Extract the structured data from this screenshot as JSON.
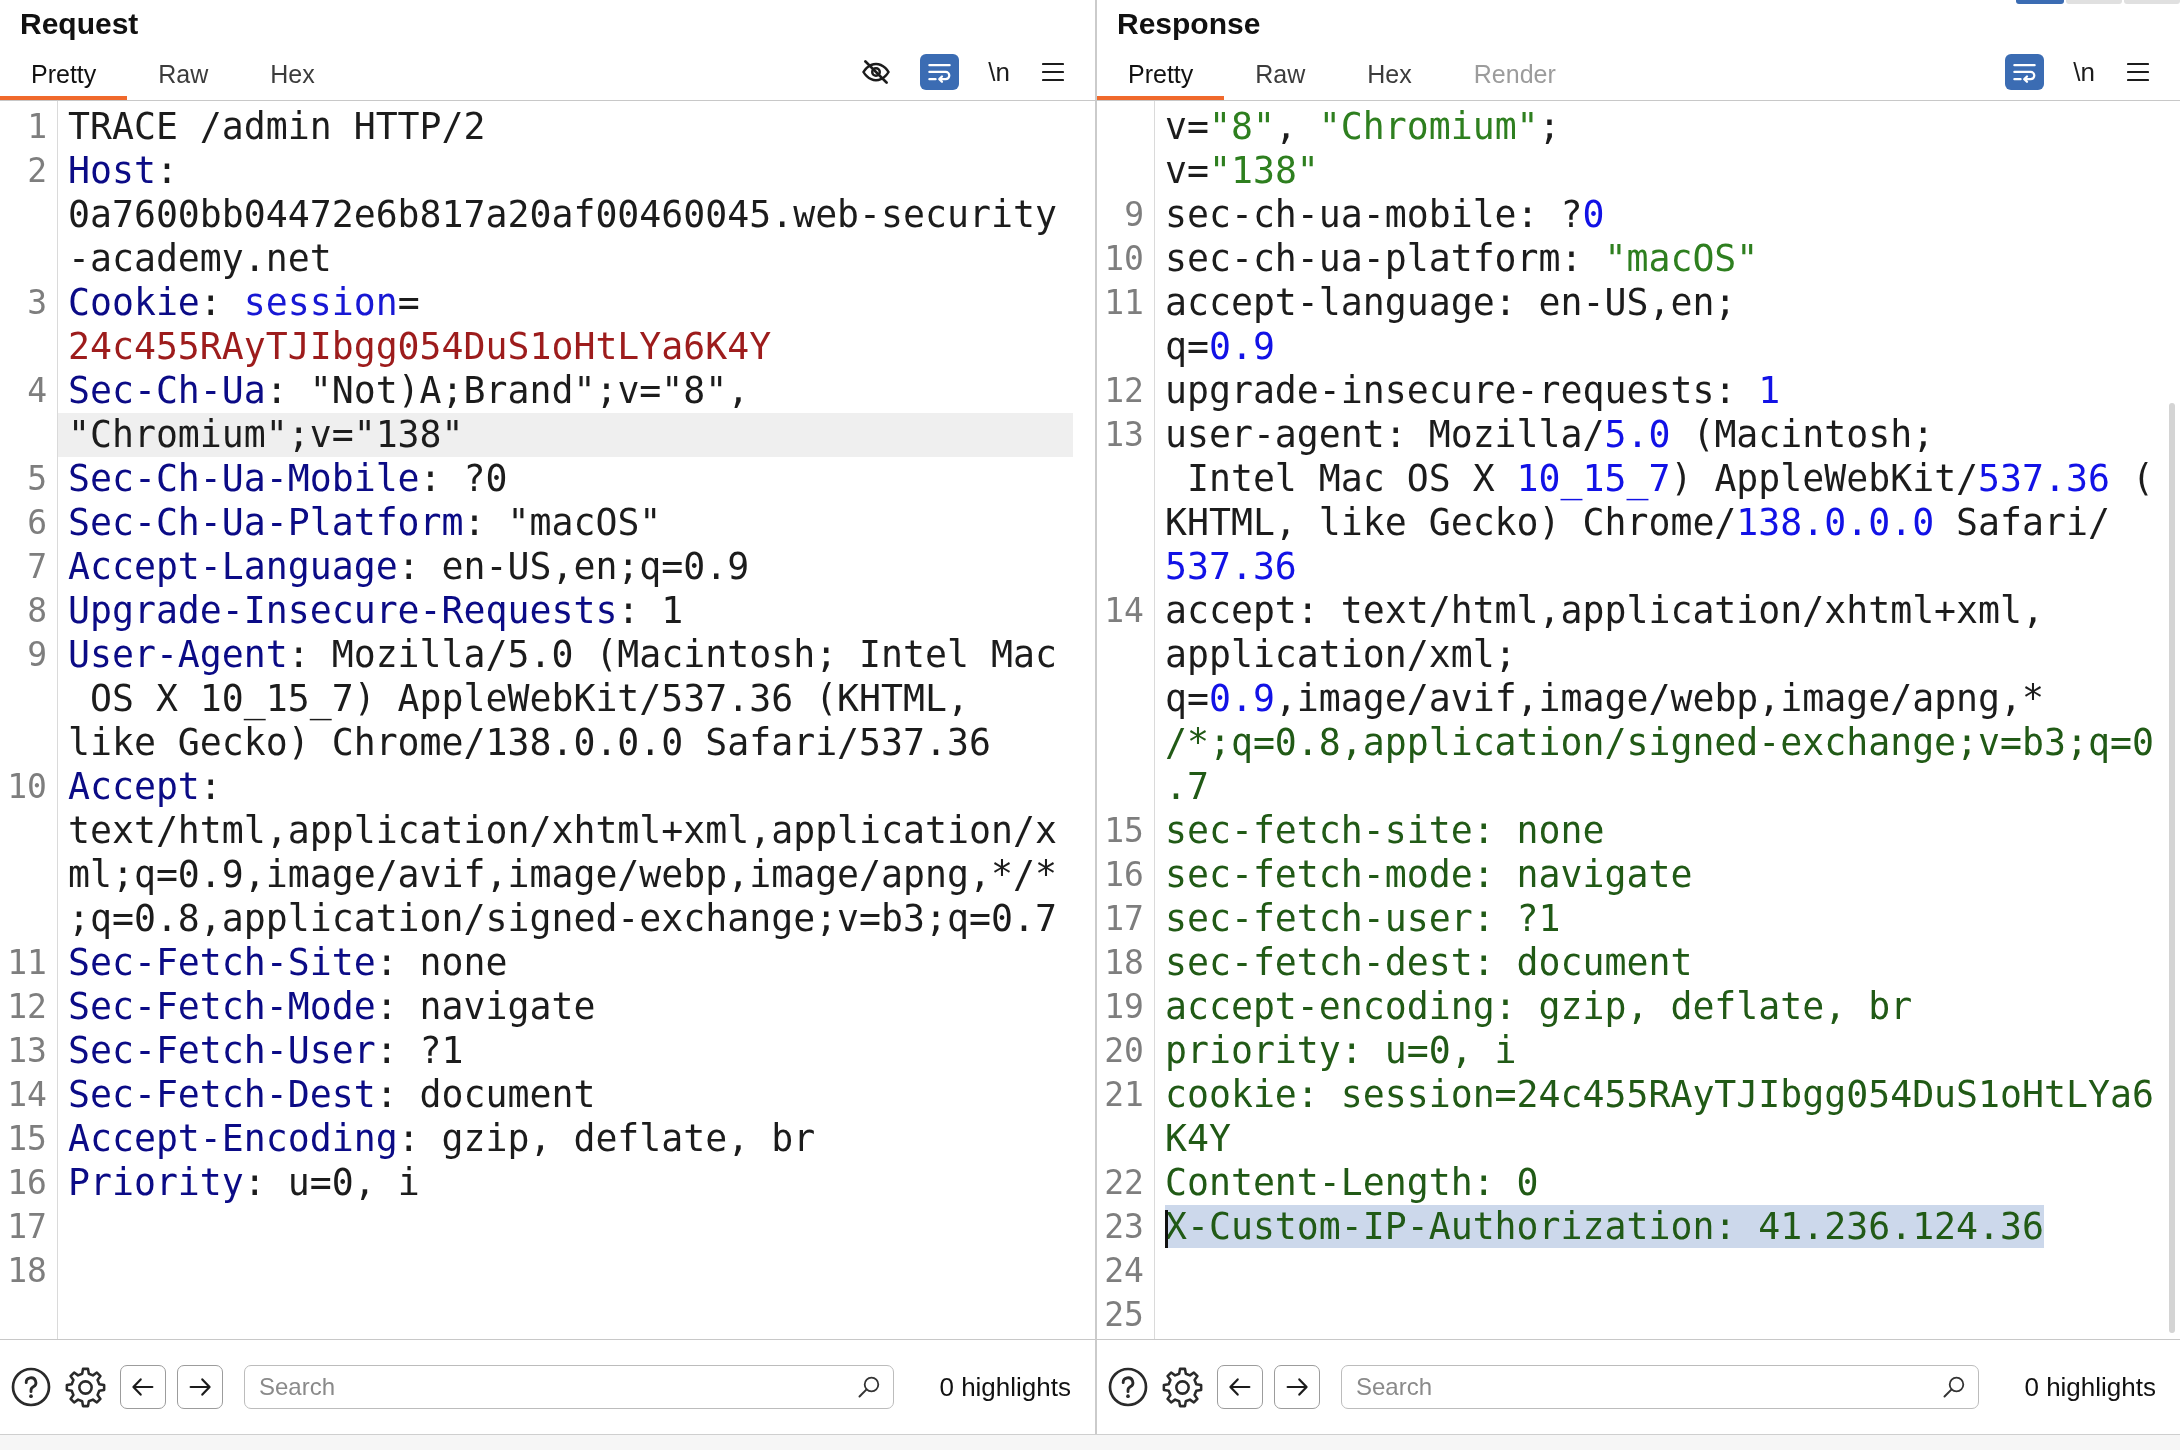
{
  "panels": [
    {
      "title": "Request",
      "tabs": [
        {
          "label": "Pretty",
          "selected": true,
          "disabled": false
        },
        {
          "label": "Raw",
          "selected": false,
          "disabled": false
        },
        {
          "label": "Hex",
          "selected": false,
          "disabled": false
        }
      ],
      "toolbar": [
        {
          "kind": "hide-toggle",
          "on": false
        },
        {
          "kind": "wrap-toggle",
          "on": true
        },
        {
          "kind": "newline-toggle",
          "label": "\\n",
          "on": false
        },
        {
          "kind": "menu"
        }
      ],
      "lines": [
        {
          "number": "1",
          "rows": [
            {
              "tokens": [
                {
                  "kind": "plain",
                  "text": "TRACE /admin HTTP/2"
                }
              ]
            }
          ]
        },
        {
          "number": "2",
          "rows": [
            {
              "tokens": [
                {
                  "kind": "name",
                  "text": "Host"
                },
                {
                  "kind": "plain",
                  "text": ":"
                }
              ]
            },
            {
              "tokens": [
                {
                  "kind": "plain",
                  "text": "0a7600bb04472e6b817a20af00460045.web-security"
                }
              ]
            },
            {
              "tokens": [
                {
                  "kind": "plain",
                  "text": "-academy.net"
                }
              ]
            }
          ]
        },
        {
          "number": "3",
          "rows": [
            {
              "tokens": [
                {
                  "kind": "name",
                  "text": "Cookie"
                },
                {
                  "kind": "plain",
                  "text": ": "
                },
                {
                  "kind": "param",
                  "text": "session"
                },
                {
                  "kind": "plain",
                  "text": "="
                }
              ]
            },
            {
              "tokens": [
                {
                  "kind": "cookie",
                  "text": "24c455RAyTJIbgg054DuS1oHtLYa6K4Y"
                }
              ]
            }
          ]
        },
        {
          "number": "4",
          "rows": [
            {
              "tokens": [
                {
                  "kind": "name",
                  "text": "Sec-Ch-Ua"
                },
                {
                  "kind": "plain",
                  "text": ": \"Not)A;Brand\";v=\"8\","
                }
              ]
            },
            {
              "current_line": true,
              "tokens": [
                {
                  "kind": "plain",
                  "text": "\"Chromium\";v=\"138\""
                }
              ]
            }
          ]
        },
        {
          "number": "5",
          "rows": [
            {
              "tokens": [
                {
                  "kind": "name",
                  "text": "Sec-Ch-Ua-Mobile"
                },
                {
                  "kind": "plain",
                  "text": ": ?0"
                }
              ]
            }
          ]
        },
        {
          "number": "6",
          "rows": [
            {
              "tokens": [
                {
                  "kind": "name",
                  "text": "Sec-Ch-Ua-Platform"
                },
                {
                  "kind": "plain",
                  "text": ": \"macOS\""
                }
              ]
            }
          ]
        },
        {
          "number": "7",
          "rows": [
            {
              "tokens": [
                {
                  "kind": "name",
                  "text": "Accept-Language"
                },
                {
                  "kind": "plain",
                  "text": ": en-US,en;q=0.9"
                }
              ]
            }
          ]
        },
        {
          "number": "8",
          "rows": [
            {
              "tokens": [
                {
                  "kind": "name",
                  "text": "Upgrade-Insecure-Requests"
                },
                {
                  "kind": "plain",
                  "text": ": 1"
                }
              ]
            }
          ]
        },
        {
          "number": "9",
          "rows": [
            {
              "tokens": [
                {
                  "kind": "name",
                  "text": "User-Agent"
                },
                {
                  "kind": "plain",
                  "text": ": Mozilla/5.0 (Macintosh; Intel Mac"
                }
              ]
            },
            {
              "tokens": [
                {
                  "kind": "plain",
                  "text": " OS X 10_15_7) AppleWebKit/537.36 (KHTML,"
                }
              ]
            },
            {
              "tokens": [
                {
                  "kind": "plain",
                  "text": "like Gecko) Chrome/138.0.0.0 Safari/537.36"
                }
              ]
            }
          ]
        },
        {
          "number": "10",
          "rows": [
            {
              "tokens": [
                {
                  "kind": "name",
                  "text": "Accept"
                },
                {
                  "kind": "plain",
                  "text": ":"
                }
              ]
            },
            {
              "tokens": [
                {
                  "kind": "plain",
                  "text": "text/html,application/xhtml+xml,application/x"
                }
              ]
            },
            {
              "tokens": [
                {
                  "kind": "plain",
                  "text": "ml;q=0.9,image/avif,image/webp,image/apng,*/*"
                }
              ]
            },
            {
              "tokens": [
                {
                  "kind": "plain",
                  "text": ";q=0.8,application/signed-exchange;v=b3;q=0.7"
                }
              ]
            }
          ]
        },
        {
          "number": "11",
          "rows": [
            {
              "tokens": [
                {
                  "kind": "name",
                  "text": "Sec-Fetch-Site"
                },
                {
                  "kind": "plain",
                  "text": ": none"
                }
              ]
            }
          ]
        },
        {
          "number": "12",
          "rows": [
            {
              "tokens": [
                {
                  "kind": "name",
                  "text": "Sec-Fetch-Mode"
                },
                {
                  "kind": "plain",
                  "text": ": navigate"
                }
              ]
            }
          ]
        },
        {
          "number": "13",
          "rows": [
            {
              "tokens": [
                {
                  "kind": "name",
                  "text": "Sec-Fetch-User"
                },
                {
                  "kind": "plain",
                  "text": ": ?1"
                }
              ]
            }
          ]
        },
        {
          "number": "14",
          "rows": [
            {
              "tokens": [
                {
                  "kind": "name",
                  "text": "Sec-Fetch-Dest"
                },
                {
                  "kind": "plain",
                  "text": ": document"
                }
              ]
            }
          ]
        },
        {
          "number": "15",
          "rows": [
            {
              "tokens": [
                {
                  "kind": "name",
                  "text": "Accept-Encoding"
                },
                {
                  "kind": "plain",
                  "text": ": gzip, deflate, br"
                }
              ]
            }
          ]
        },
        {
          "number": "16",
          "rows": [
            {
              "tokens": [
                {
                  "kind": "name",
                  "text": "Priority"
                },
                {
                  "kind": "plain",
                  "text": ": u=0, i"
                }
              ]
            }
          ]
        },
        {
          "number": "17"
        },
        {
          "number": "18"
        }
      ],
      "search": {
        "placeholder": "Search"
      },
      "highlights": "0 highlights"
    },
    {
      "title": "Response",
      "view_toggle": [
        {
          "selected": true
        },
        {
          "selected": false
        },
        {
          "selected": false
        }
      ],
      "tabs": [
        {
          "label": "Pretty",
          "selected": true,
          "disabled": false
        },
        {
          "label": "Raw",
          "selected": false,
          "disabled": false
        },
        {
          "label": "Hex",
          "selected": false,
          "disabled": false
        },
        {
          "label": "Render",
          "selected": false,
          "disabled": true
        }
      ],
      "toolbar": [
        {
          "kind": "wrap-toggle",
          "on": true
        },
        {
          "kind": "newline-toggle",
          "label": "\\n",
          "on": false
        },
        {
          "kind": "menu"
        }
      ],
      "scrollbar": true,
      "lines": [
        {
          "rows": [
            {
              "tokens": [
                {
                  "kind": "plain",
                  "text": "v="
                },
                {
                  "kind": "string",
                  "text": "\"8\""
                },
                {
                  "kind": "plain",
                  "text": ", "
                },
                {
                  "kind": "string",
                  "text": "\"Chromium\""
                },
                {
                  "kind": "plain",
                  "text": ";"
                }
              ]
            },
            {
              "tokens": [
                {
                  "kind": "plain",
                  "text": "v="
                },
                {
                  "kind": "string",
                  "text": "\"138\""
                }
              ]
            }
          ]
        },
        {
          "number": "9",
          "rows": [
            {
              "tokens": [
                {
                  "kind": "plain",
                  "text": "sec-ch-ua-mobile: ?"
                },
                {
                  "kind": "number",
                  "text": "0"
                }
              ]
            }
          ]
        },
        {
          "number": "10",
          "rows": [
            {
              "tokens": [
                {
                  "kind": "plain",
                  "text": "sec-ch-ua-platform: "
                },
                {
                  "kind": "string",
                  "text": "\"macOS\""
                }
              ]
            }
          ]
        },
        {
          "number": "11",
          "rows": [
            {
              "tokens": [
                {
                  "kind": "plain",
                  "text": "accept-language: en-US,en;"
                }
              ]
            },
            {
              "tokens": [
                {
                  "kind": "plain",
                  "text": "q="
                },
                {
                  "kind": "number",
                  "text": "0.9"
                }
              ]
            }
          ]
        },
        {
          "number": "12",
          "rows": [
            {
              "tokens": [
                {
                  "kind": "plain",
                  "text": "upgrade-insecure-requests: "
                },
                {
                  "kind": "number",
                  "text": "1"
                }
              ]
            }
          ]
        },
        {
          "number": "13",
          "rows": [
            {
              "tokens": [
                {
                  "kind": "plain",
                  "text": "user-agent: Mozilla/"
                },
                {
                  "kind": "number",
                  "text": "5.0"
                },
                {
                  "kind": "plain",
                  "text": " (Macintosh;"
                }
              ]
            },
            {
              "tokens": [
                {
                  "kind": "plain",
                  "text": " Intel Mac OS X "
                },
                {
                  "kind": "number",
                  "text": "10_15_7"
                },
                {
                  "kind": "plain",
                  "text": ") AppleWebKit/"
                },
                {
                  "kind": "number",
                  "text": "537.36"
                },
                {
                  "kind": "plain",
                  "text": " ("
                }
              ]
            },
            {
              "tokens": [
                {
                  "kind": "plain",
                  "text": "KHTML, like Gecko) Chrome/"
                },
                {
                  "kind": "number",
                  "text": "138.0.0.0"
                },
                {
                  "kind": "plain",
                  "text": " Safari/"
                }
              ]
            },
            {
              "tokens": [
                {
                  "kind": "number",
                  "text": "537.36"
                }
              ]
            }
          ]
        },
        {
          "number": "14",
          "rows": [
            {
              "tokens": [
                {
                  "kind": "plain",
                  "text": "accept: text/html,application/xhtml+xml,"
                }
              ]
            },
            {
              "tokens": [
                {
                  "kind": "plain",
                  "text": "application/xml;"
                }
              ]
            },
            {
              "tokens": [
                {
                  "kind": "plain",
                  "text": "q="
                },
                {
                  "kind": "number",
                  "text": "0.9"
                },
                {
                  "kind": "plain",
                  "text": ",image/avif,image/webp,image/apng,*"
                }
              ]
            },
            {
              "tokens": [
                {
                  "kind": "comment",
                  "text": "/*;q=0.8,application/signed-exchange;v=b3;q=0"
                }
              ]
            },
            {
              "tokens": [
                {
                  "kind": "comment",
                  "text": ".7"
                }
              ]
            }
          ]
        },
        {
          "number": "15",
          "rows": [
            {
              "tokens": [
                {
                  "kind": "comment",
                  "text": "sec-fetch-site: none"
                }
              ]
            }
          ]
        },
        {
          "number": "16",
          "rows": [
            {
              "tokens": [
                {
                  "kind": "comment",
                  "text": "sec-fetch-mode: navigate"
                }
              ]
            }
          ]
        },
        {
          "number": "17",
          "rows": [
            {
              "tokens": [
                {
                  "kind": "comment",
                  "text": "sec-fetch-user: ?1"
                }
              ]
            }
          ]
        },
        {
          "number": "18",
          "rows": [
            {
              "tokens": [
                {
                  "kind": "comment",
                  "text": "sec-fetch-dest: document"
                }
              ]
            }
          ]
        },
        {
          "number": "19",
          "rows": [
            {
              "tokens": [
                {
                  "kind": "comment",
                  "text": "accept-encoding: gzip, deflate, br"
                }
              ]
            }
          ]
        },
        {
          "number": "20",
          "rows": [
            {
              "tokens": [
                {
                  "kind": "comment",
                  "text": "priority: u=0, i"
                }
              ]
            }
          ]
        },
        {
          "number": "21",
          "rows": [
            {
              "tokens": [
                {
                  "kind": "comment",
                  "text": "cookie: session=24c455RAyTJIbgg054DuS1oHtLYa6"
                }
              ]
            },
            {
              "tokens": [
                {
                  "kind": "comment",
                  "text": "K4Y"
                }
              ]
            }
          ]
        },
        {
          "number": "22",
          "rows": [
            {
              "tokens": [
                {
                  "kind": "comment",
                  "text": "Content-Length: 0"
                }
              ]
            }
          ]
        },
        {
          "number": "23",
          "rows": [
            {
              "selected_text": true,
              "caret": true,
              "tokens": [
                {
                  "kind": "comment",
                  "text": "X-Custom-IP-Authorization: 41.236.124.36"
                }
              ]
            }
          ]
        },
        {
          "number": "24"
        },
        {
          "number": "25"
        }
      ],
      "search": {
        "placeholder": "Search"
      },
      "highlights": "0 highlights"
    }
  ]
}
